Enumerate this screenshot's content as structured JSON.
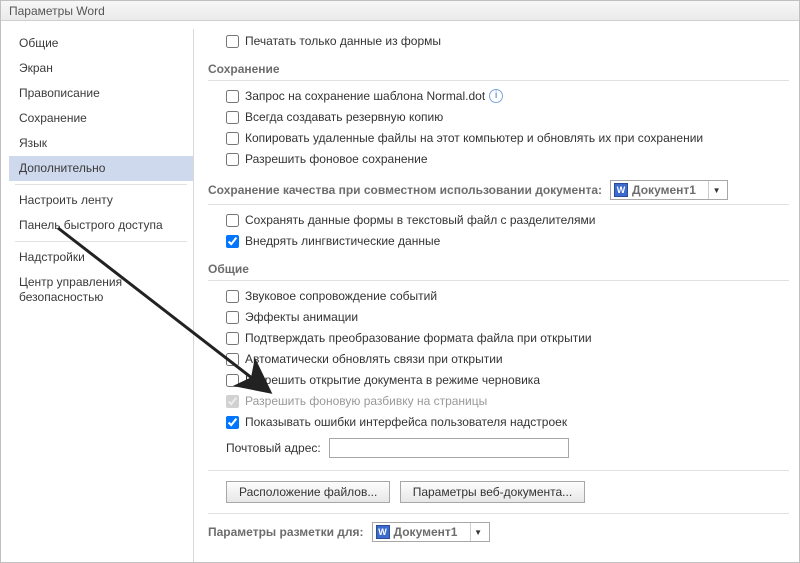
{
  "title": "Параметры Word",
  "sidebar": {
    "items": [
      {
        "label": "Общие"
      },
      {
        "label": "Экран"
      },
      {
        "label": "Правописание"
      },
      {
        "label": "Сохранение"
      },
      {
        "label": "Язык"
      },
      {
        "label": "Дополнительно"
      },
      {
        "label": "Настроить ленту"
      },
      {
        "label": "Панель быстрого доступа"
      },
      {
        "label": "Надстройки"
      },
      {
        "label": "Центр управления безопасностью"
      }
    ],
    "selected_index": 5
  },
  "print": {
    "form_data_only": "Печатать только данные из формы"
  },
  "save_section": {
    "header": "Сохранение",
    "prompt_normal": "Запрос на сохранение шаблона Normal.dot",
    "create_backup": "Всегда создавать резервную копию",
    "copy_remote": "Копировать удаленные файлы на этот компьютер и обновлять их при сохранении",
    "allow_bg_save": "Разрешить фоновое сохранение"
  },
  "fidelity_section": {
    "header": "Сохранение качества при совместном использовании документа:",
    "doc_selector": "Документ1",
    "save_form_data": "Сохранять данные формы в текстовый файл с разделителями",
    "embed_linguistic": "Внедрять лингвистические данные"
  },
  "general_section": {
    "header": "Общие",
    "sound_feedback": "Звуковое сопровождение событий",
    "animation": "Эффекты анимации",
    "confirm_convert": "Подтверждать преобразование формата файла при открытии",
    "update_links": "Автоматически обновлять связи при открытии",
    "allow_draft": "Разрешить открытие документа в режиме черновика",
    "allow_bg_pagination": "Разрешить фоновую разбивку на страницы",
    "show_addin_errors": "Показывать ошибки интерфейса пользователя надстроек",
    "mailing_label": "Почтовый адрес:",
    "mailing_value": "",
    "file_locations_btn": "Расположение файлов...",
    "web_options_btn": "Параметры веб-документа..."
  },
  "layout_section": {
    "header": "Параметры разметки для:",
    "doc_selector": "Документ1"
  }
}
